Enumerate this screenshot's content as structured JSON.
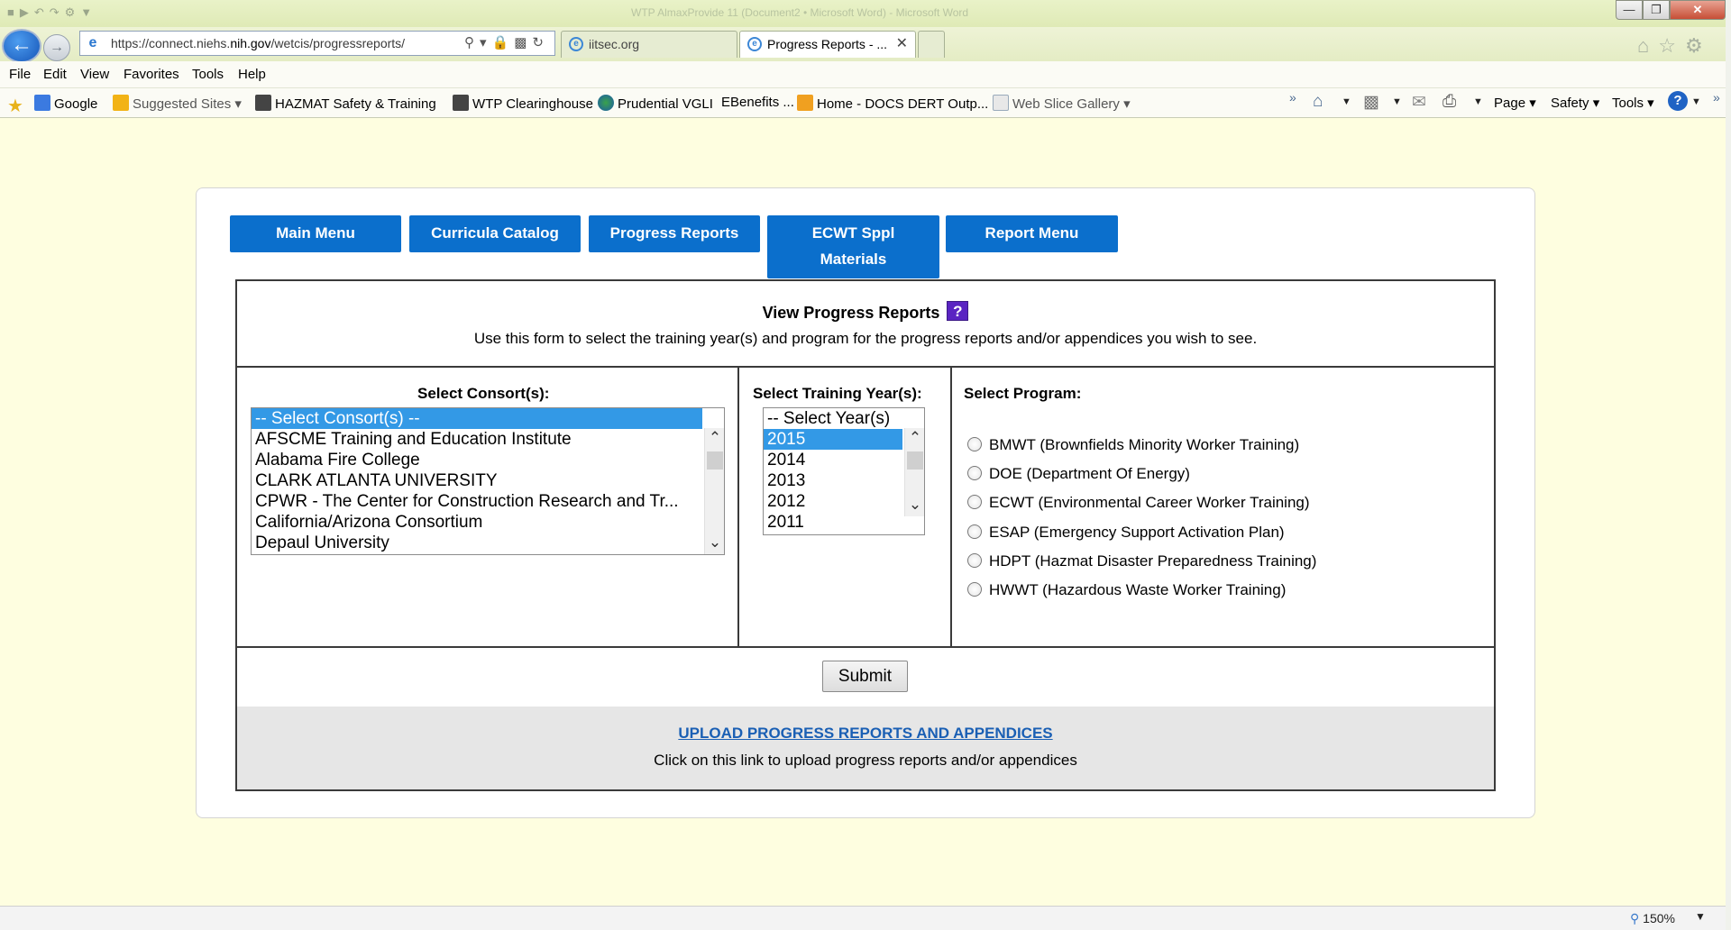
{
  "browser": {
    "title_faded": "WTP AlmaxProvide 11 (Document2 • Microsoft Word) - Microsoft Word",
    "url_prefix": "https://connect.niehs.",
    "url_domain": "nih.gov",
    "url_path": "/wetcis/progressreports/",
    "tabs": [
      {
        "label": "iitsec.org"
      },
      {
        "label": "Progress Reports - ..."
      }
    ],
    "menu": [
      "File",
      "Edit",
      "View",
      "Favorites",
      "Tools",
      "Help"
    ],
    "favorites": [
      "Google",
      "Suggested Sites ▾",
      "HAZMAT Safety & Training",
      "WTP Clearinghouse",
      "Prudential VGLI",
      "EBenefits ...",
      "Home - DOCS DERT Outp...",
      "Web Slice Gallery ▾"
    ],
    "commands": [
      "Page ▾",
      "Safety ▾",
      "Tools ▾"
    ],
    "zoom": "150%"
  },
  "nav": {
    "main_menu": "Main Menu",
    "curricula": "Curricula Catalog",
    "progress": "Progress Reports",
    "ecwt_line1": "ECWT Sppl",
    "ecwt_line2": "Materials",
    "report_menu": "Report Menu"
  },
  "form": {
    "title": "View Progress Reports",
    "help_glyph": "?",
    "description": "Use this form to select the training year(s) and program for the progress reports and/or appendices you wish to see.",
    "consort_label": "Select Consort(s):",
    "consorts": [
      "-- Select Consort(s) --",
      "AFSCME Training and Education Institute",
      "Alabama Fire College",
      "CLARK ATLANTA UNIVERSITY",
      "CPWR - The Center for Construction Research and Tr...",
      "California/Arizona Consortium",
      "Depaul University"
    ],
    "year_label": "Select Training Year(s):",
    "years": [
      "-- Select Year(s)",
      "2015",
      "2014",
      "2013",
      "2012",
      "2011"
    ],
    "program_label": "Select Program:",
    "programs": [
      "BMWT (Brownfields Minority Worker Training)",
      "DOE (Department Of Energy)",
      "ECWT (Environmental Career Worker Training)",
      "ESAP (Emergency Support Activation Plan)",
      "HDPT (Hazmat Disaster Preparedness Training)",
      "HWWT (Hazardous Waste Worker Training)"
    ],
    "submit": "Submit",
    "upload_link": "UPLOAD PROGRESS REPORTS AND APPENDICES",
    "upload_desc": "Click on this link to upload progress reports and/or appendices"
  }
}
